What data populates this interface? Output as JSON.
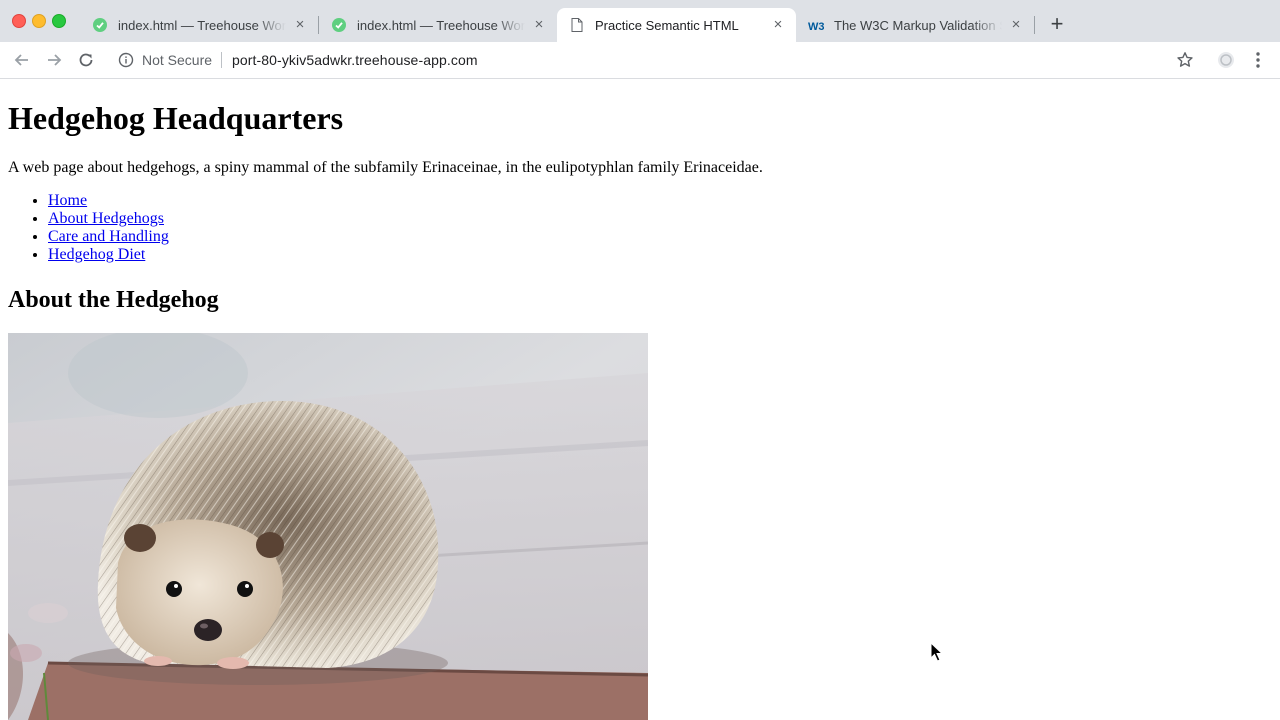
{
  "browser": {
    "tabs": [
      {
        "title": "index.html — Treehouse Workspaces",
        "favicon": "treehouse-icon",
        "active": false
      },
      {
        "title": "index.html — Treehouse Workspaces",
        "favicon": "treehouse-icon",
        "active": false
      },
      {
        "title": "Practice Semantic HTML",
        "favicon": "document-icon",
        "active": true
      },
      {
        "title": "The W3C Markup Validation Service",
        "favicon": "w3c-icon",
        "active": false
      }
    ],
    "address_bar": {
      "security_label": "Not Secure",
      "url": "port-80-ykiv5adwkr.treehouse-app.com"
    }
  },
  "page": {
    "heading": "Hedgehog Headquarters",
    "intro": "A web page about hedgehogs, a spiny mammal of the subfamily Erinaceinae, in the eulipotyphlan family Erinaceidae.",
    "nav_links": [
      "Home",
      "About Hedgehogs",
      "Care and Handling",
      "Hedgehog Diet"
    ],
    "section_heading": "About the Hedgehog"
  },
  "colors": {
    "link": "#0000ee",
    "tabstrip": "#dee1e6",
    "treehouse_green": "#5fcf80"
  }
}
